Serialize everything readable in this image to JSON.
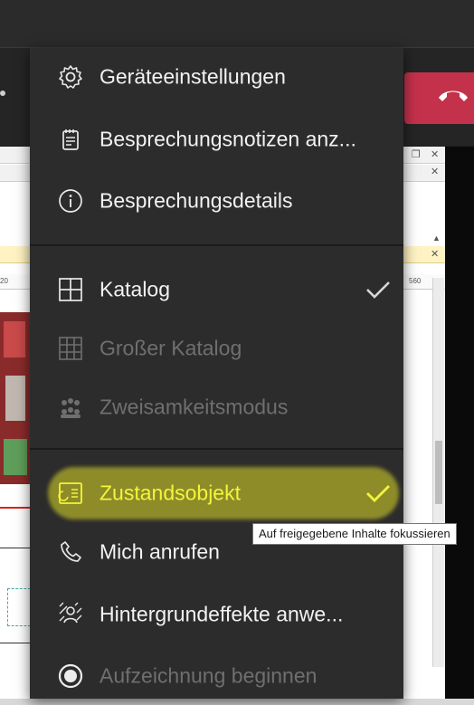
{
  "menu": {
    "items": [
      {
        "label": "Geräteeinstellungen",
        "icon": "gear-icon",
        "enabled": true,
        "checked": false
      },
      {
        "label": "Besprechungsnotizen anz...",
        "icon": "notes-icon",
        "enabled": true,
        "checked": false
      },
      {
        "label": "Besprechungsdetails",
        "icon": "info-icon",
        "enabled": true,
        "checked": false
      },
      {
        "label": "Katalog",
        "icon": "gallery-icon",
        "enabled": true,
        "checked": true
      },
      {
        "label": "Großer Katalog",
        "icon": "large-gallery-icon",
        "enabled": false,
        "checked": false
      },
      {
        "label": "Zweisamkeitsmodus",
        "icon": "together-mode-icon",
        "enabled": false,
        "checked": false
      },
      {
        "label": "Zustandsobjekt",
        "icon": "focus-content-icon",
        "enabled": true,
        "checked": true,
        "highlighted": true
      },
      {
        "label": "Mich anrufen",
        "icon": "phone-icon",
        "enabled": true,
        "checked": false
      },
      {
        "label": "Hintergrundeffekte anwe...",
        "icon": "background-effects-icon",
        "enabled": true,
        "checked": false
      },
      {
        "label": "Aufzeichnung beginnen",
        "icon": "record-icon",
        "enabled": false,
        "checked": false
      }
    ]
  },
  "tooltip": {
    "text": "Auf freigegebene Inhalte fokussieren"
  },
  "shared_window": {
    "ruler_labels": [
      "20",
      "560"
    ]
  },
  "colors": {
    "menu_bg": "#2d2c2c",
    "hangup": "#c4314b",
    "highlight": "#e5e52e",
    "disabled_text": "#6f6f6f"
  }
}
